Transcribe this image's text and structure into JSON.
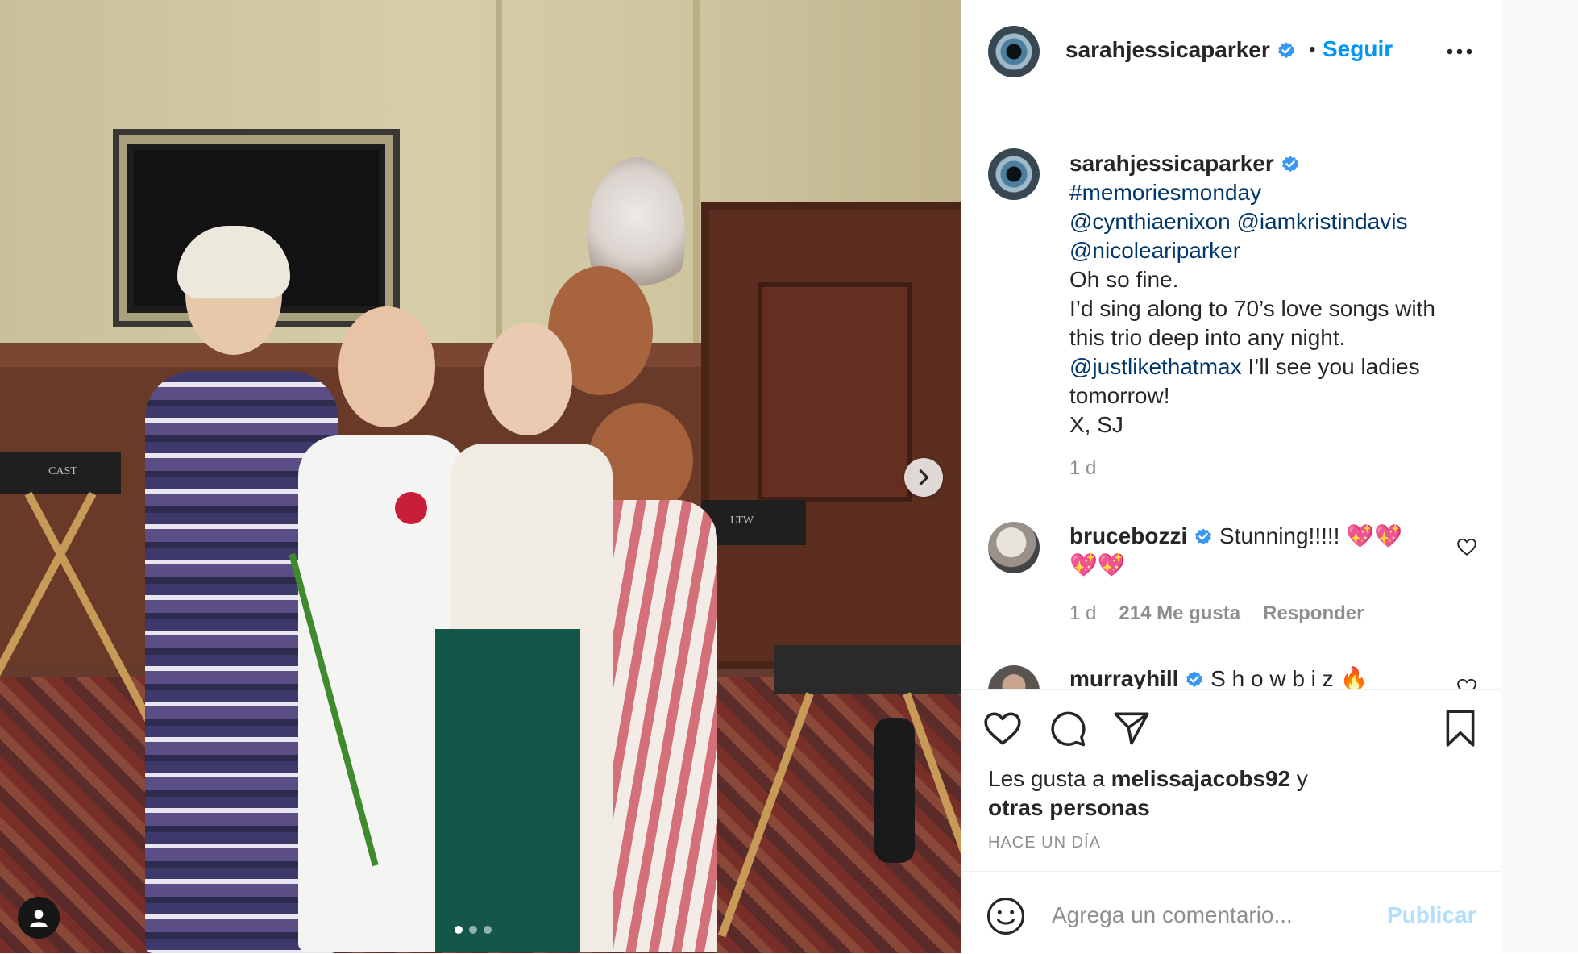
{
  "photo": {
    "alt": "",
    "chair_label_1": "CAST",
    "chair_label_2": "LTW",
    "dots_count": 3,
    "active_dot": 1
  },
  "header": {
    "username": "sarahjessicaparker",
    "separator": "•",
    "follow_label": "Seguir",
    "more_icon": "more-horizontal-icon"
  },
  "caption": {
    "username": "sarahjessicaparker",
    "hashtag": "#memoriesmonday",
    "mention1": "@cynthiaenixon",
    "mention2": "@iamkristindavis",
    "mention3": "@nicoleariparker",
    "line1": "Oh so fine.",
    "line2": "I’d sing along to 70’s love songs with this trio deep into any night.",
    "mention4": "@justlikethatmax",
    "line3": " I’ll see you ladies tomorrow!",
    "signoff": "X, SJ",
    "time": "1 d"
  },
  "comments": [
    {
      "username": "brucebozzi",
      "text": "Stunning!!!!! 💖💖💖💖",
      "time": "1 d",
      "likes": "214 Me gusta",
      "reply_label": "Responder"
    },
    {
      "username": "murrayhill",
      "text": "S h o w b i z 🔥"
    }
  ],
  "actions": {
    "likes_prefix": "Les gusta a ",
    "likes_user": "melissajacobs92",
    "likes_suffix": " y",
    "likes_others": "otras personas",
    "timestamp": "HACE UN DÍA"
  },
  "composer": {
    "placeholder": "Agrega un comentario...",
    "publish_label": "Publicar"
  },
  "colors": {
    "accent": "#0095f6",
    "link": "#00376b",
    "muted": "#8e8e8e",
    "publish_disabled": "#b2dffc"
  }
}
